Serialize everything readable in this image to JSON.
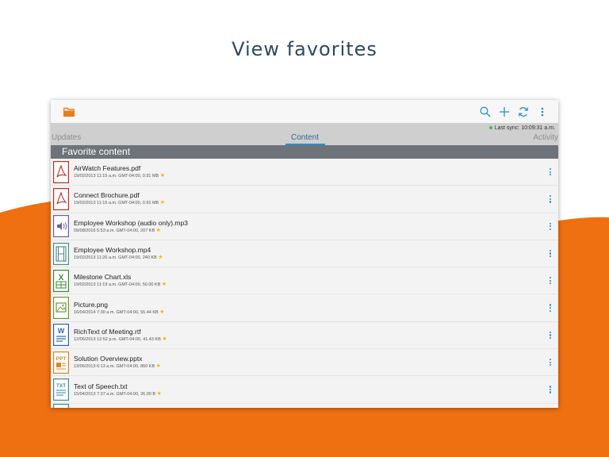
{
  "headline": "View favorites",
  "colors": {
    "accent_orange": "#ee7011",
    "text_dark": "#2f4a5f",
    "accent_blue": "#2d8ec5"
  },
  "toolbar": {
    "icons": [
      "folder-icon",
      "search-icon",
      "add-icon",
      "sync-icon",
      "overflow-menu-icon"
    ]
  },
  "sync": {
    "label": "Last sync: 10:09:31 a.m."
  },
  "tabs": [
    "Updates",
    "Content",
    "Activity"
  ],
  "section_title": "Favorite content",
  "files": [
    {
      "name": "AirWatch Features.pdf",
      "meta": "19/02/2013  11:15 a.m. GMT-04:00, 0.91 MB",
      "type": "pdf",
      "color": "#b8322b"
    },
    {
      "name": "Connect Brochure.pdf",
      "meta": "19/02/2013  11:15 a.m. GMT-04:00, 0.91 MB",
      "type": "pdf",
      "color": "#b8322b"
    },
    {
      "name": "Employee Workshop (audio only).mp3",
      "meta": "09/08/2016  5:53 a.m. GMT-04:00, 207 KB",
      "type": "audio",
      "color": "#6f5fa3"
    },
    {
      "name": "Employee Workshop.mp4",
      "meta": "19/02/2013  11:26 a.m. GMT-04:00, 240 KB",
      "type": "video",
      "color": "#4f8b8f"
    },
    {
      "name": "Milestone Chart.xls",
      "meta": "19/02/2013  11:19 a.m. GMT-04:00, 50.00 KB",
      "type": "xls",
      "color": "#3d8a35"
    },
    {
      "name": "Picture.png",
      "meta": "16/04/2014  7:30 a.m. GMT-04:00, 55.44 KB",
      "type": "image",
      "color": "#6f9a3b"
    },
    {
      "name": "RichText of Meeting.rtf",
      "meta": "12/06/2013  12:52 p.m. GMT-04:00, 41.43 KB",
      "type": "doc",
      "color": "#2b64a8"
    },
    {
      "name": "Solution Overview.pptx",
      "meta": "13/06/2013  6:13 a.m. GMT-04:00, 850 KB",
      "type": "ppt",
      "color": "#d08a2a"
    },
    {
      "name": "Text of Speech.txt",
      "meta": "15/04/2013  7:37 a.m. GMT-04:00, 26.00 B",
      "type": "txt",
      "color": "#3e8ea0"
    }
  ]
}
